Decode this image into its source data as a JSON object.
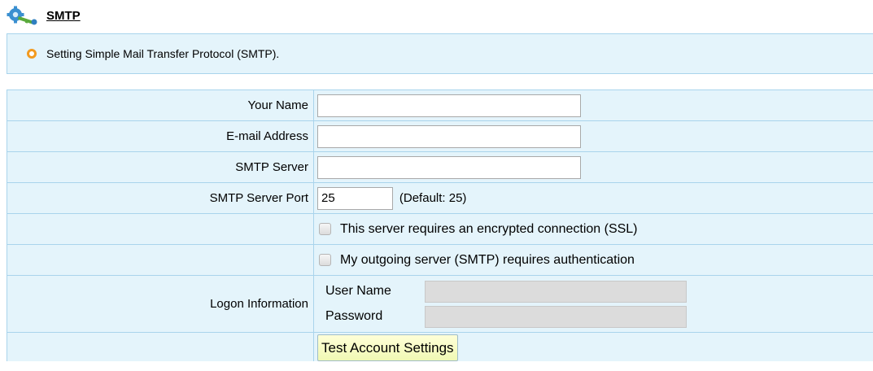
{
  "header": {
    "title": "SMTP",
    "icon": "gear-key-icon"
  },
  "info": {
    "text": "Setting Simple Mail Transfer Protocol (SMTP).",
    "bullet_color": "#f29a1f"
  },
  "form": {
    "your_name": {
      "label": "Your Name",
      "value": ""
    },
    "email_address": {
      "label": "E-mail Address",
      "value": ""
    },
    "smtp_server": {
      "label": "SMTP Server",
      "value": ""
    },
    "smtp_port": {
      "label": "SMTP Server Port",
      "value": "25",
      "hint": "(Default: 25)"
    },
    "ssl_checkbox": {
      "label": "This server requires an encrypted connection (SSL)",
      "checked": false
    },
    "auth_checkbox": {
      "label": "My outgoing server (SMTP) requires authentication",
      "checked": false
    },
    "logon": {
      "label": "Logon Information",
      "user_name_label": "User Name",
      "user_name_value": "",
      "password_label": "Password",
      "password_value": ""
    },
    "test_button_label": "Test Account Settings"
  },
  "colors": {
    "panel_bg": "#e4f4fb",
    "border": "#a9d4ec",
    "disabled_input": "#dcdcdc",
    "button_bg": "#f4f9c0"
  }
}
